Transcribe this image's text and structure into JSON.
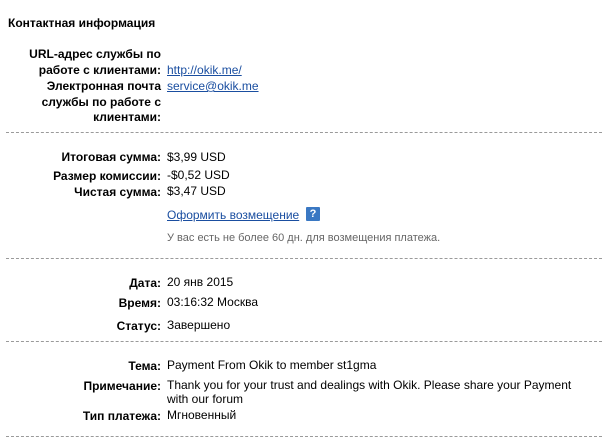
{
  "section_title": "Контактная информация",
  "contact": {
    "url_label_line1": "URL-адрес службы по",
    "url_label_line2": "работе с клиентами:",
    "url_value": "http://okik.me/",
    "email_label_line1": "Электронная почта",
    "email_label_line2": "службы по работе с",
    "email_label_line3": "клиентами:",
    "email_value": "service@okik.me"
  },
  "amounts": {
    "total_label": "Итоговая сумма:",
    "total_value": "$3,99 USD",
    "fee_label": "Размер комиссии:",
    "fee_value": "-$0,52 USD",
    "net_label": "Чистая сумма:",
    "net_value": "$3,47 USD",
    "refund_link": "Оформить возмещение",
    "help_icon_glyph": "?",
    "refund_note": "У вас есть не более 60 дн. для возмещения платежа."
  },
  "details": {
    "date_label": "Дата:",
    "date_value": "20 янв 2015",
    "time_label": "Время:",
    "time_value": "03:16:32 Москва",
    "status_label": "Статус:",
    "status_value": "Завершено"
  },
  "message": {
    "subject_label": "Тема:",
    "subject_value": "Payment From Okik to member st1gma",
    "note_label": "Примечание:",
    "note_line1": "Thank you for your trust and dealings with Okik. Please share your Payment",
    "note_line2": "with our forum",
    "type_label": "Тип платежа:",
    "type_value": "Мгновенный"
  },
  "colors": {
    "link": "#1a4ea0",
    "help_icon": "#3a78c3",
    "note_text": "#666666",
    "divider": "#9a9a9a"
  }
}
